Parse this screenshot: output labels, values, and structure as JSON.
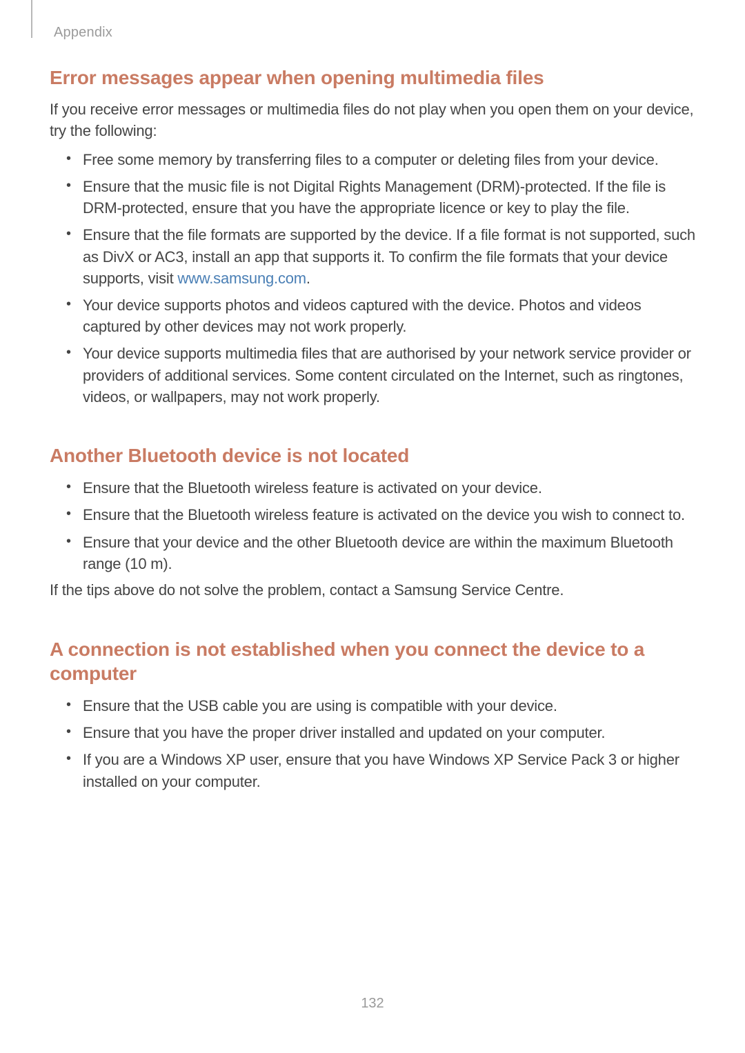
{
  "header": {
    "section": "Appendix"
  },
  "page_number": "132",
  "sections": {
    "s1": {
      "heading": "Error messages appear when opening multimedia files",
      "intro": "If you receive error messages or multimedia files do not play when you open them on your device, try the following:",
      "items": {
        "b1": "Free some memory by transferring files to a computer or deleting files from your device.",
        "b2": "Ensure that the music file is not Digital Rights Management (DRM)-protected. If the file is DRM-protected, ensure that you have the appropriate licence or key to play the file.",
        "b3_pre": "Ensure that the file formats are supported by the device. If a file format is not supported, such as DivX or AC3, install an app that supports it. To confirm the file formats that your device supports, visit ",
        "b3_link": "www.samsung.com",
        "b3_post": ".",
        "b4": "Your device supports photos and videos captured with the device. Photos and videos captured by other devices may not work properly.",
        "b5": "Your device supports multimedia files that are authorised by your network service provider or providers of additional services. Some content circulated on the Internet, such as ringtones, videos, or wallpapers, may not work properly."
      }
    },
    "s2": {
      "heading": "Another Bluetooth device is not located",
      "items": {
        "b1": "Ensure that the Bluetooth wireless feature is activated on your device.",
        "b2": "Ensure that the Bluetooth wireless feature is activated on the device you wish to connect to.",
        "b3": "Ensure that your device and the other Bluetooth device are within the maximum Bluetooth range (10 m)."
      },
      "outro": "If the tips above do not solve the problem, contact a Samsung Service Centre."
    },
    "s3": {
      "heading": "A connection is not established when you connect the device to a computer",
      "items": {
        "b1": "Ensure that the USB cable you are using is compatible with your device.",
        "b2": "Ensure that you have the proper driver installed and updated on your computer.",
        "b3": "If you are a Windows XP user, ensure that you have Windows XP Service Pack 3 or higher installed on your computer."
      }
    }
  }
}
